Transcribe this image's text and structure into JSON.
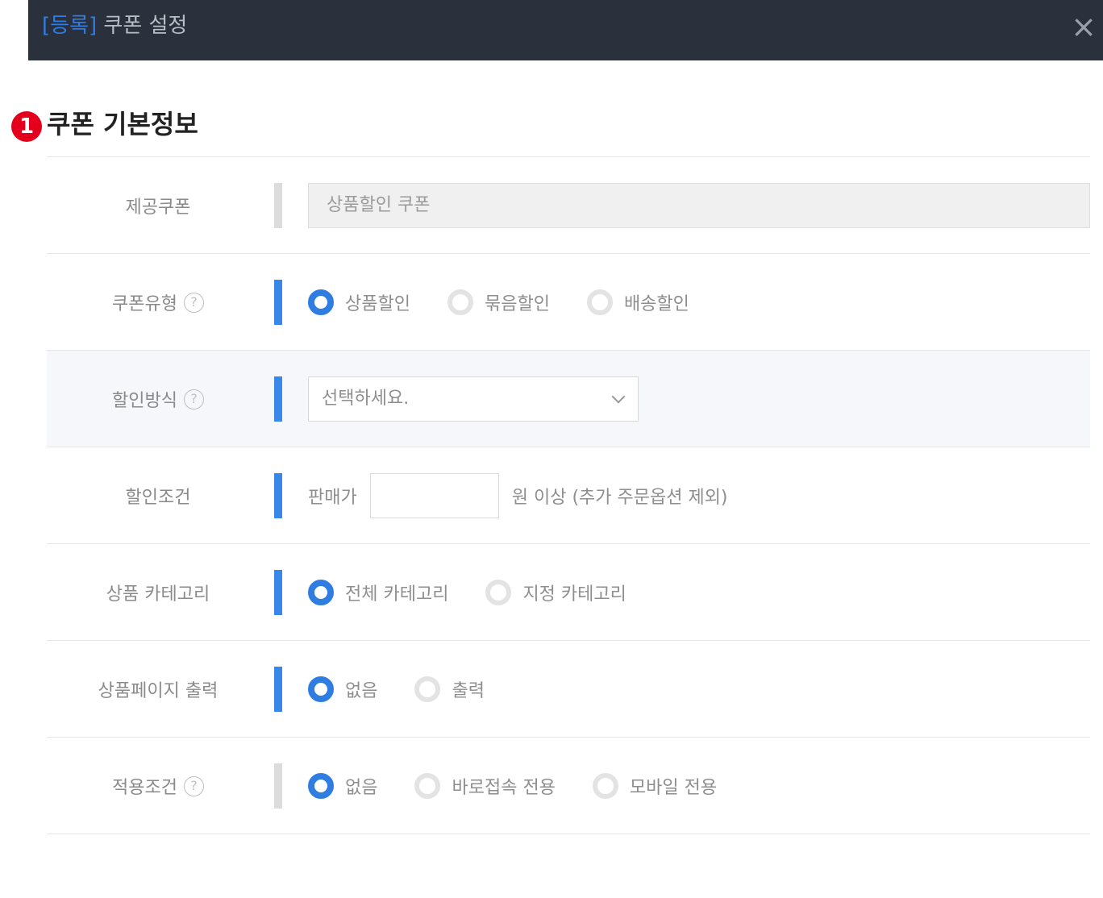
{
  "header": {
    "tag": "[등록]",
    "title": "쿠폰 설정",
    "close": "×"
  },
  "section": {
    "number": "1",
    "title": "쿠폰 기본정보"
  },
  "rows": {
    "provided_coupon": {
      "label": "제공쿠폰",
      "value": "상품할인 쿠폰"
    },
    "coupon_type": {
      "label": "쿠폰유형",
      "help": "?",
      "options": [
        "상품할인",
        "묶음할인",
        "배송할인"
      ],
      "selected": "상품할인"
    },
    "discount_method": {
      "label": "할인방식",
      "help": "?",
      "placeholder": "선택하세요."
    },
    "discount_condition": {
      "label": "할인조건",
      "prefix": "판매가",
      "value": "",
      "suffix": "원 이상 (추가 주문옵션 제외)"
    },
    "product_category": {
      "label": "상품 카테고리",
      "options": [
        "전체 카테고리",
        "지정 카테고리"
      ],
      "selected": "전체 카테고리"
    },
    "product_page_output": {
      "label": "상품페이지 출력",
      "options": [
        "없음",
        "출력"
      ],
      "selected": "없음"
    },
    "apply_condition": {
      "label": "적용조건",
      "help": "?",
      "options": [
        "없음",
        "바로접속 전용",
        "모바일 전용"
      ],
      "selected": "없음"
    }
  },
  "colors": {
    "header_bg": "#2a303c",
    "accent": "#2f7de1",
    "badge": "#e4001c"
  }
}
